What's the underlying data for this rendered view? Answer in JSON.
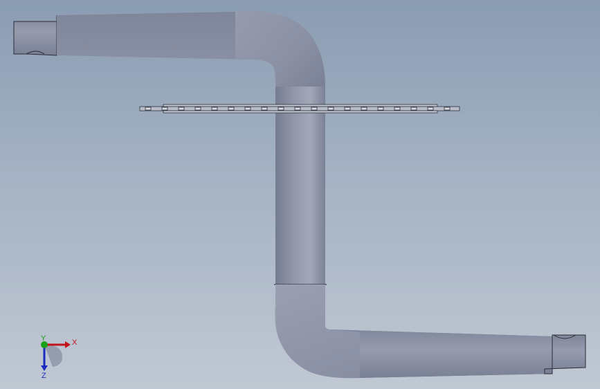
{
  "viewport": {
    "background_top": "#8b9db3",
    "background_bottom": "#c0c8d3",
    "part_color": "#8a90a3",
    "part_highlight": "#aab0c0",
    "part_edge": "#000000"
  },
  "triad": {
    "x_label": "X",
    "y_label": "Y",
    "z_label": "Z",
    "x_color": "#c0141a",
    "y_color": "#1aa01a",
    "z_color": "#1a2ac0"
  }
}
